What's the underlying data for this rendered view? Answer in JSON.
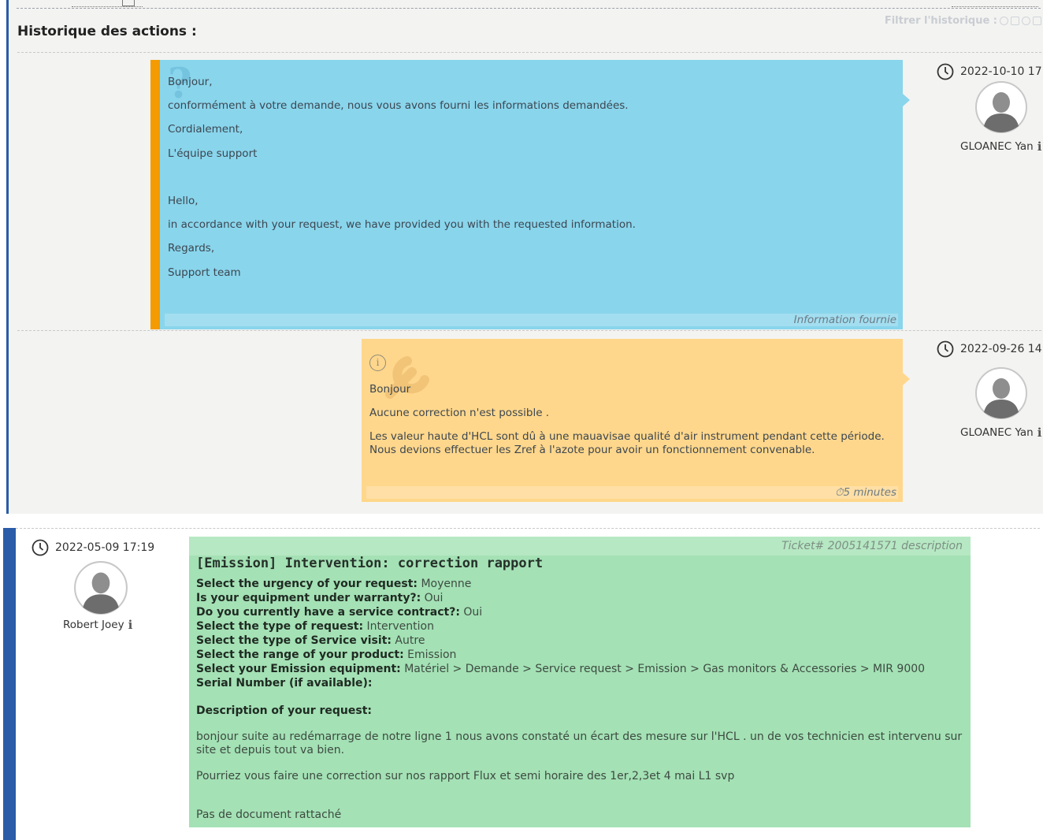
{
  "history": {
    "title": "Historique des actions :",
    "filter_label": "Filtrer l'historique :",
    "entries": [
      {
        "lines": [
          "Bonjour,",
          "conformément à votre demande, nous vous avons fourni les informations demandées.",
          "Cordialement,",
          "L'équipe support",
          "Hello,",
          "in accordance with your request, we have provided you with the requested information.",
          "Regards,",
          "Support team"
        ],
        "footer": "Information fournie",
        "date": "2022-10-10 17",
        "author": "GLOANEC Yan",
        "color": "#89d5ec",
        "accent": "#f39b00"
      },
      {
        "lines": [
          "Bonjour",
          "Aucune correction n'est possible .",
          "Les valeur haute d'HCL sont dû à une mauavisae qualité d'air instrument pendant cette période.",
          "Nous devions effectuer les Zref à l'azote pour avoir un fonctionnement convenable."
        ],
        "footer": "5 minutes",
        "date": "2022-09-26 14",
        "author": "GLOANEC Yan",
        "color": "#ffd78c"
      }
    ]
  },
  "description": {
    "date": "2022-05-09 17:19",
    "author": "Robert Joey",
    "ticket_label": "Ticket# 2005141571 description",
    "title": "[Emission] Intervention: correction rapport",
    "fields": [
      {
        "label": "Select the urgency of your request:",
        "value": " Moyenne"
      },
      {
        "label": "Is your equipment under warranty?:",
        "value": " Oui"
      },
      {
        "label": "Do you currently have a service contract?:",
        "value": " Oui"
      },
      {
        "label": "Select the type of request:",
        "value": " Intervention"
      },
      {
        "label": "Select the type of Service visit:",
        "value": " Autre"
      },
      {
        "label": "Select the range of your product:",
        "value": " Emission"
      },
      {
        "label": "Select your Emission equipment:",
        "value": " Matériel > Demande > Service request > Emission > Gas monitors & Accessories > MIR 9000"
      },
      {
        "label": "Serial Number (if available):",
        "value": ""
      }
    ],
    "description_heading": "Description of your request:",
    "paragraph_1": "bonjour suite au redémarrage de notre ligne 1 nous avons constaté un écart des mesure sur l'HCL . un de vos technicien est intervenu sur site et depuis tout va bien.",
    "paragraph_2": "Pourriez vous faire une correction sur nos rapport Flux et semi horaire des 1er,2,3et 4 mai L1 svp",
    "attachment_note": "Pas de document rattaché",
    "color": "#a4e1b5"
  }
}
